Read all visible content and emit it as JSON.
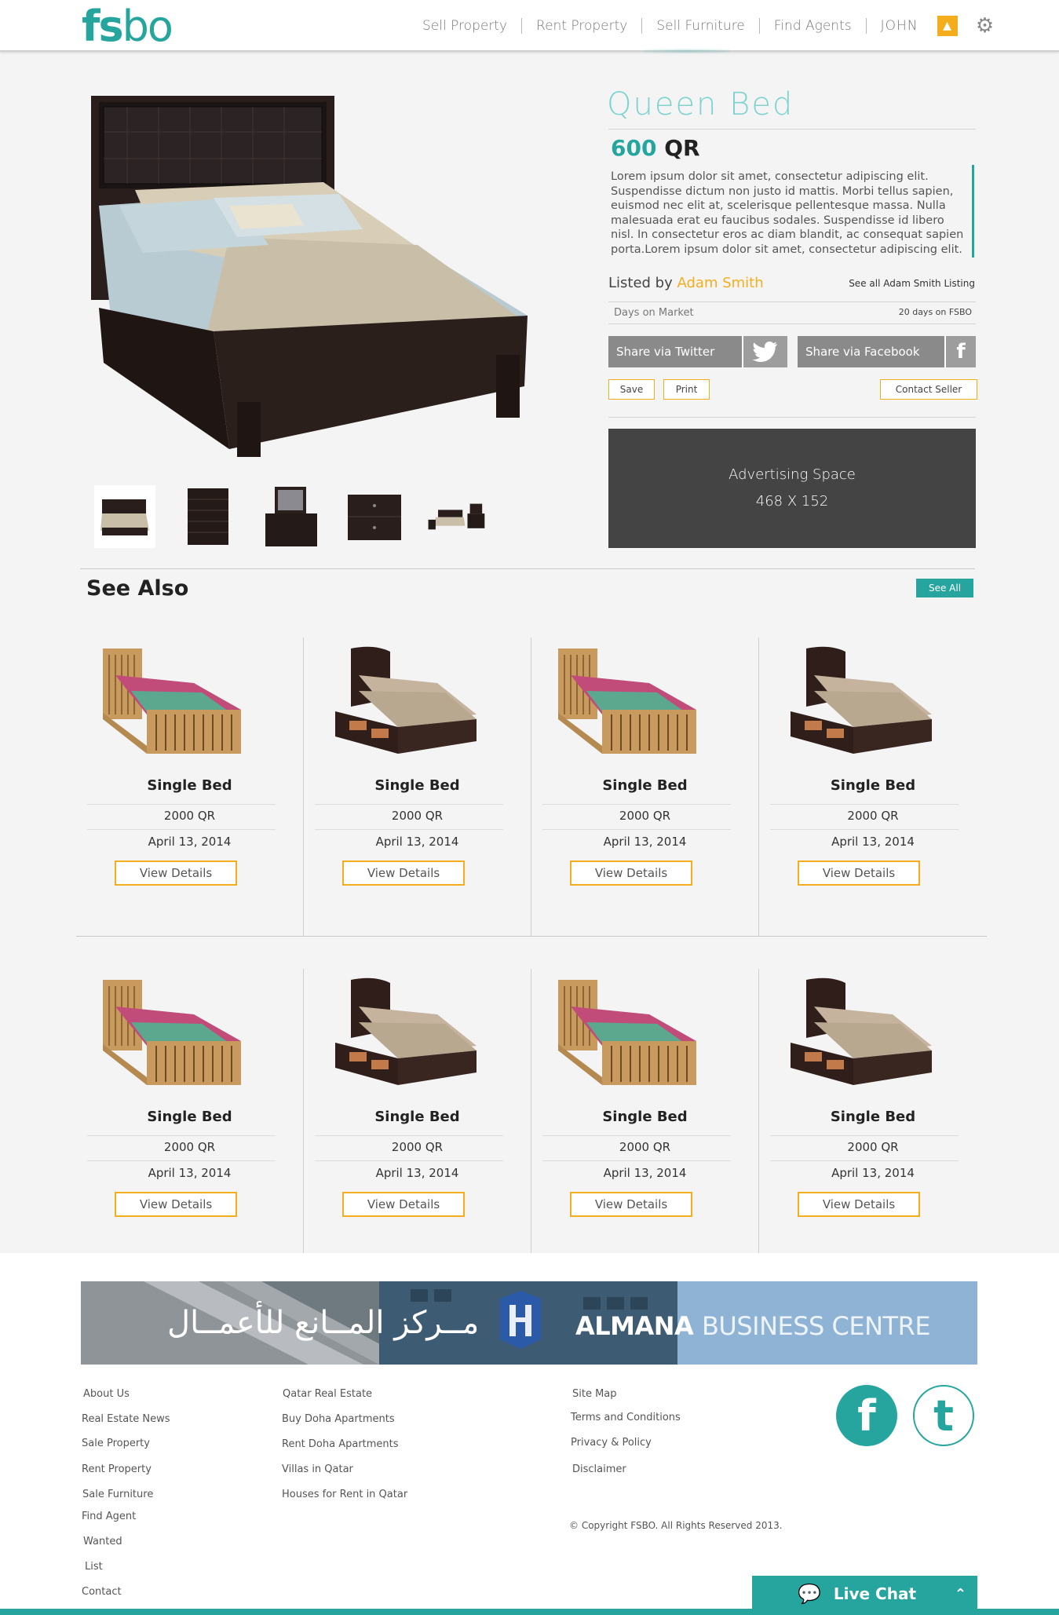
{
  "header": {
    "logo": "fsbo",
    "nav": [
      "Sell Property",
      "Rent Property",
      "Sell Furniture",
      "Find Agents"
    ],
    "user": "JOHN"
  },
  "product": {
    "title": "Queen  Bed",
    "price": "600",
    "currency": "QR",
    "description": "Lorem ipsum dolor sit amet, consectetur adipiscing elit. Suspendisse dictum non justo id mattis. Morbi tellus sapien, euismod nec elit at, scelerisque pellentesque massa. Nulla malesuada erat eu faucibus sodales. Suspendisse id libero nisl. In consectetur eros ac diam blandit, ac consequat sapien porta.Lorem ipsum dolor sit amet, consectetur adipiscing elit.",
    "listed_prefix": "Listed by",
    "seller": "Adam Smith",
    "see_all_listing": "See all Adam Smith Listing",
    "days_label": "Days on Market",
    "days_value": "20 days on FSBO",
    "share_twitter": "Share via Twitter",
    "share_facebook": "Share via Facebook",
    "save": "Save",
    "print": "Print",
    "contact": "Contact Seller"
  },
  "ad": {
    "line1": "Advertising Space",
    "line2": "468 X 152"
  },
  "see_also": {
    "title": "See Also",
    "see_all": "See All",
    "items": [
      {
        "name": "Single Bed",
        "price": "2000 QR",
        "date": "April 13, 2014",
        "button": "View Details",
        "image": "wood-bed-icon"
      },
      {
        "name": "Single Bed",
        "price": "2000 QR",
        "date": "April 13, 2014",
        "button": "View Details",
        "image": "dark-bed-icon"
      },
      {
        "name": "Single Bed",
        "price": "2000 QR",
        "date": "April 13, 2014",
        "button": "View Details",
        "image": "wood-bed-icon"
      },
      {
        "name": "Single Bed",
        "price": "2000 QR",
        "date": "April 13, 2014",
        "button": "View Details",
        "image": "dark-bed-icon"
      },
      {
        "name": "Single Bed",
        "price": "2000 QR",
        "date": "April 13, 2014",
        "button": "View Details",
        "image": "wood-bed-icon"
      },
      {
        "name": "Single Bed",
        "price": "2000 QR",
        "date": "April 13, 2014",
        "button": "View Details",
        "image": "dark-bed-icon"
      },
      {
        "name": "Single Bed",
        "price": "2000 QR",
        "date": "April 13, 2014",
        "button": "View Details",
        "image": "wood-bed-icon"
      },
      {
        "name": "Single Bed",
        "price": "2000 QR",
        "date": "April 13, 2014",
        "button": "View Details",
        "image": "dark-bed-icon"
      }
    ]
  },
  "banner": {
    "arabic": "مــركز المــانع للأعمــال",
    "name_bold": "ALMANA",
    "name_light": "BUSINESS CENTRE"
  },
  "footer": {
    "col1": [
      "About Us",
      "Real Estate News",
      "Sale Property",
      "Rent Property",
      "Sale Furniture",
      "Find Agent",
      "Wanted",
      "List",
      "Contact"
    ],
    "col2": [
      "Qatar Real Estate",
      "Buy Doha Apartments",
      "Rent Doha Apartments",
      "Villas in Qatar",
      "Houses for Rent in Qatar"
    ],
    "col3": [
      "Site Map",
      "Terms and Conditions",
      "Privacy & Policy",
      "Disclaimer"
    ],
    "copyright": "© Copyright FSBO. All Rights Reserved 2013.",
    "live_chat": "Live Chat"
  },
  "colors": {
    "teal": "#25a59e",
    "yellow": "#f4ae1d",
    "dark": "#444444"
  }
}
